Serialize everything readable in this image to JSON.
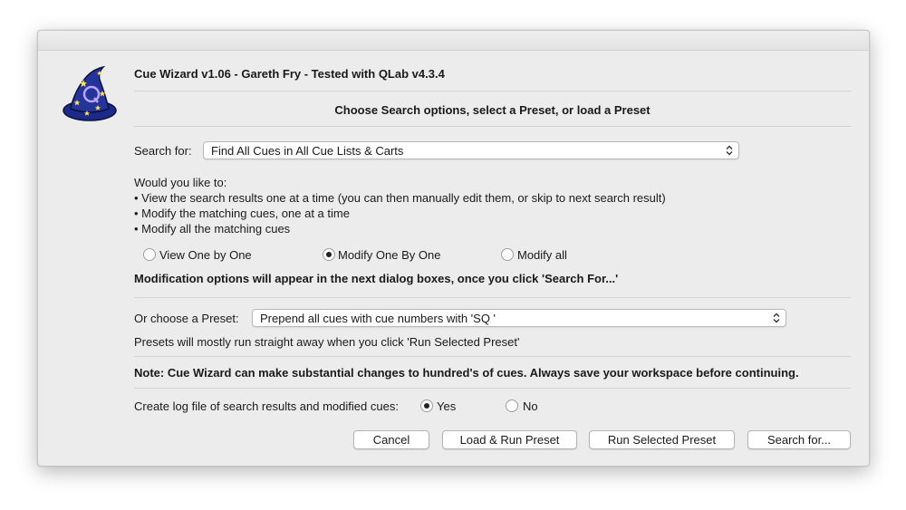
{
  "dialog": {
    "title": "Cue Wizard v1.06 - Gareth Fry - Tested with QLab v4.3.4",
    "subtitle": "Choose Search options, select a Preset, or load a Preset",
    "icon": "wizard-hat-icon"
  },
  "search": {
    "label": "Search for:",
    "selected": "Find All Cues in All Cue Lists & Carts"
  },
  "mode": {
    "intro": "Would you like to:",
    "bullets": [
      "• View the search results one at a time (you can then manually edit them, or skip to next search result)",
      "• Modify the matching cues, one at a time",
      "• Modify all the matching cues"
    ],
    "options": [
      {
        "label": "View One by One",
        "selected": false
      },
      {
        "label": "Modify One By One",
        "selected": true
      },
      {
        "label": "Modify all",
        "selected": false
      }
    ],
    "note": "Modification options will appear in the next dialog boxes, once you click 'Search For...'"
  },
  "preset": {
    "label": "Or choose a Preset:",
    "selected": "Prepend all cues with cue numbers with 'SQ '",
    "hint": "Presets will mostly run straight away when you click 'Run Selected Preset'"
  },
  "warning": "Note: Cue Wizard can make substantial changes to hundred's of cues. Always save your workspace before continuing.",
  "log": {
    "label": "Create log file of search results and modified cues:",
    "yes": "Yes",
    "no": "No",
    "selected": "yes"
  },
  "buttons": {
    "cancel": "Cancel",
    "load_run": "Load & Run Preset",
    "run_selected": "Run Selected Preset",
    "search_for": "Search for..."
  }
}
